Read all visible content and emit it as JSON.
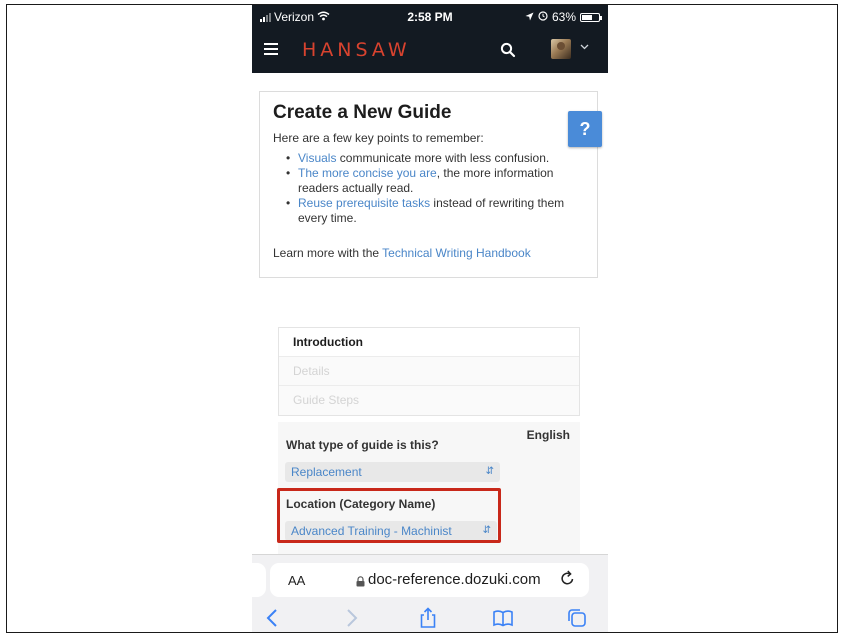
{
  "status_bar": {
    "carrier": "Verizon",
    "time": "2:58 PM",
    "battery": "63%",
    "battery_level": 0.63
  },
  "navbar": {
    "brand": "HANSAW",
    "menu_icon": "hamburger-icon",
    "search_icon": "search-icon",
    "avatar_icon": "user-avatar",
    "chevron_icon": "chevron-down-icon"
  },
  "tips": {
    "title": "Create a New Guide",
    "subtitle": "Here are a few key points to remember:",
    "items": [
      {
        "link": "Visuals",
        "text": " communicate more with less confusion."
      },
      {
        "link": "The more concise you are",
        "text": ", the more information readers actually read."
      },
      {
        "link": "Reuse prerequisite tasks",
        "text": " instead of rewriting them every time."
      }
    ],
    "learn_prefix": "Learn more with the ",
    "learn_link": "Technical Writing Handbook"
  },
  "help_button": {
    "label": "?"
  },
  "steps": {
    "introduction": "Introduction",
    "details": "Details",
    "guide_steps": "Guide Steps"
  },
  "form": {
    "language": "English",
    "guide_type_label": "What type of guide is this?",
    "guide_type_value": "Replacement",
    "location_label": "Location (Category Name)",
    "location_value": "Advanced Training - Machinist"
  },
  "browser": {
    "text_size": "AA",
    "url": "doc-reference.dozuki.com",
    "toolbar_icons": [
      "back-icon",
      "forward-icon",
      "share-icon",
      "bookmarks-icon",
      "tabs-icon"
    ]
  },
  "colors": {
    "navbar_bg": "#131a22",
    "brand": "#d8432f",
    "link": "#4a86c8",
    "help_bg": "#4a8bd8",
    "highlight": "#c8281a"
  }
}
